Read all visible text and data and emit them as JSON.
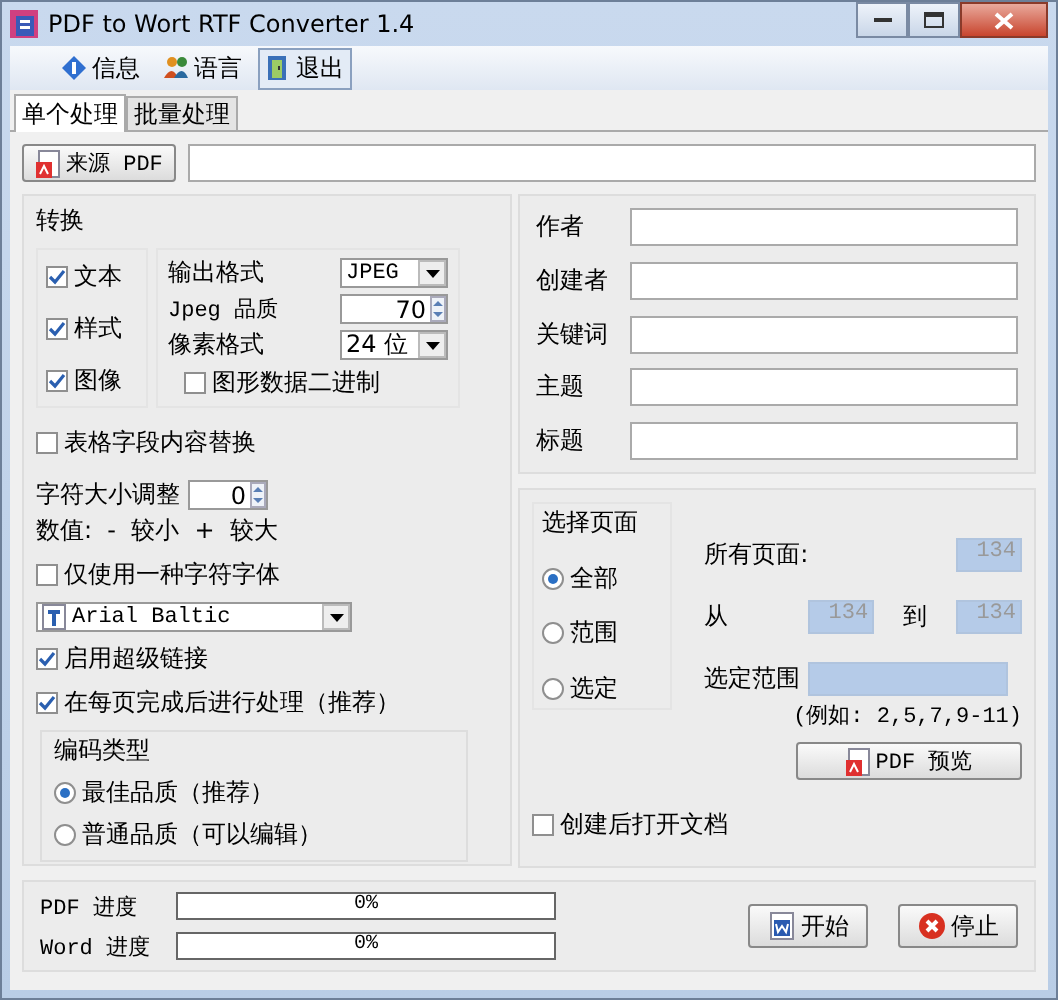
{
  "window": {
    "title": "PDF to Wort RTF Converter 1.4"
  },
  "menu": [
    {
      "label": "信息",
      "kind": "info",
      "highlighted": false
    },
    {
      "label": "语言",
      "kind": "language",
      "highlighted": false
    },
    {
      "label": "退出",
      "kind": "exit",
      "highlighted": true
    }
  ],
  "tabs": [
    {
      "label": "单个处理",
      "selected": true
    },
    {
      "label": "批量处理",
      "selected": false
    }
  ],
  "source": {
    "button": "来源 PDF"
  },
  "convert": {
    "title": "转换",
    "options": [
      {
        "label": "文本",
        "checked": true
      },
      {
        "label": "样式",
        "checked": true
      },
      {
        "label": "图像",
        "checked": true
      }
    ],
    "format_label": "输出格式",
    "format": "JPEG",
    "quality_label": "Jpeg 品质",
    "quality": "70",
    "pixel_label": "像素格式",
    "pixel": "24 位",
    "binary": {
      "label": "图形数据二进制",
      "checked": false
    }
  },
  "table_replace": {
    "label": "表格字段内容替换",
    "checked": false
  },
  "font_size": {
    "label": "字符大小调整",
    "value": "0",
    "hint": "数值:  -  较小  +  较大"
  },
  "single_font": {
    "label": "仅使用一种字符字体",
    "checked": false
  },
  "font": "Arial Baltic",
  "hyperlinks": {
    "label": "启用超级链接",
    "checked": true
  },
  "postprocess": {
    "label": "在每页完成后进行处理（推荐）",
    "checked": true
  },
  "encoding": {
    "title": "编码类型",
    "options": [
      {
        "label": "最佳品质（推荐）",
        "selected": true
      },
      {
        "label": "普通品质（可以编辑）",
        "selected": false
      }
    ]
  },
  "metadata": [
    {
      "label": "作者"
    },
    {
      "label": "创建者"
    },
    {
      "label": "关键词"
    },
    {
      "label": "主题"
    },
    {
      "label": "标题"
    }
  ],
  "pages": {
    "title": "选择页面",
    "options": [
      {
        "label": "全部",
        "selected": true
      },
      {
        "label": "范围",
        "selected": false
      },
      {
        "label": "选定",
        "selected": false
      }
    ],
    "all_label": "所有页面:",
    "all": "134",
    "from_label": "从",
    "from": "134",
    "to_label": "到",
    "to": "134",
    "selection_label": "选定范围",
    "example": "(例如: 2,5,7,9-11)",
    "preview": "PDF 预览",
    "fields_disabled": true
  },
  "open_after": {
    "label": "创建后打开文档",
    "checked": false
  },
  "progress": [
    {
      "label": "PDF 进度",
      "level": 0,
      "reading": "0%"
    },
    {
      "label": "Word 进度",
      "level": 0,
      "reading": "0%"
    }
  ],
  "buttons": [
    {
      "label": "开始",
      "kind": "start"
    },
    {
      "label": "停止",
      "kind": "stop"
    }
  ]
}
